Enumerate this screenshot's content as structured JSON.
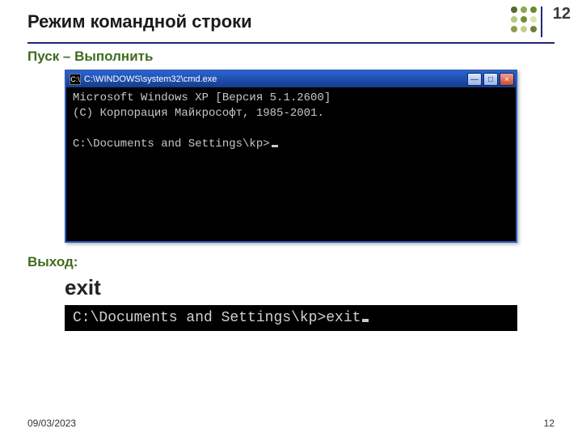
{
  "page": {
    "top_number": "12",
    "title": "Режим командной строки",
    "subtitle": "Пуск – Выполнить",
    "exit_label": "Выход:",
    "exit_cmd": "exit"
  },
  "cmdwin": {
    "title": "C:\\WINDOWS\\system32\\cmd.exe",
    "icon_glyph": "C:\\",
    "line1": "Microsoft Windows XP [Версия 5.1.2600]",
    "line2": "(С) Корпорация Майкрософт, 1985-2001.",
    "prompt": "C:\\Documents and Settings\\kp>"
  },
  "cmdstrip": {
    "text": "C:\\Documents and Settings\\kp>exit"
  },
  "footer": {
    "date": "09/03/2023",
    "num": "12"
  }
}
